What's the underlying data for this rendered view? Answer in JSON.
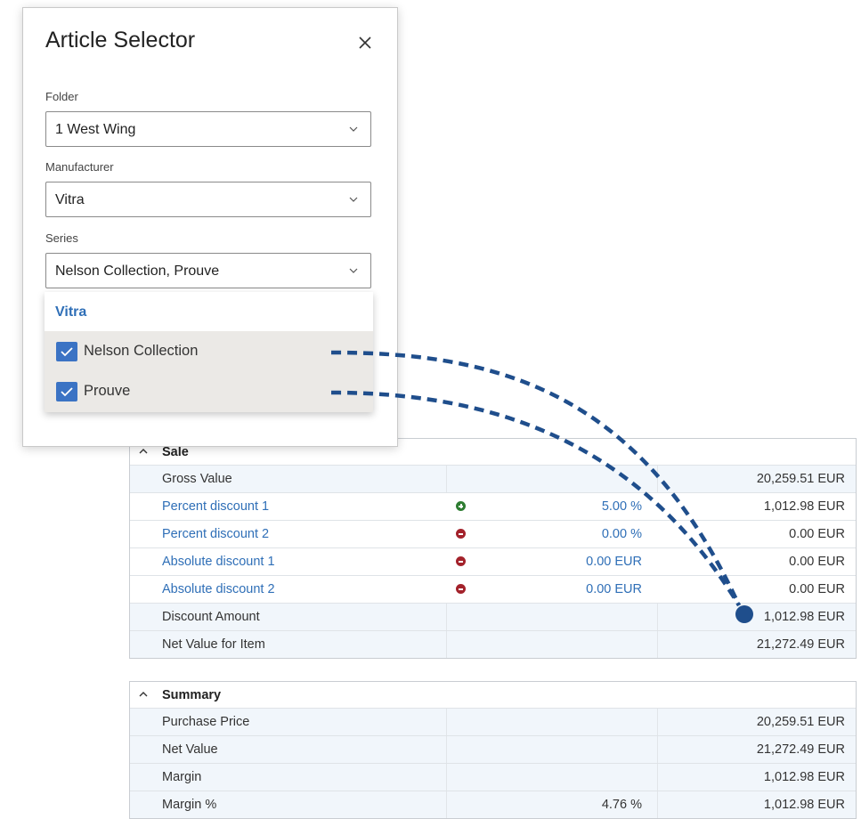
{
  "dialog": {
    "title": "Article Selector",
    "folder": {
      "label": "Folder",
      "value": "1 West Wing"
    },
    "manufacturer": {
      "label": "Manufacturer",
      "value": "Vitra"
    },
    "series": {
      "label": "Series",
      "value": "Nelson Collection, Prouve",
      "group": "Vitra",
      "options": [
        {
          "label": "Nelson Collection",
          "checked": true
        },
        {
          "label": "Prouve",
          "checked": true
        }
      ]
    }
  },
  "sale": {
    "title": "Sale",
    "rows": [
      {
        "label": "Gross Value",
        "percent": "",
        "amount": "20,259.51 EUR"
      },
      {
        "label": "Percent discount 1",
        "percent": "5.00 %",
        "amount": "1,012.98 EUR",
        "sign": "plus"
      },
      {
        "label": "Percent discount 2",
        "percent": "0.00 %",
        "amount": "0.00 EUR",
        "sign": "minus"
      },
      {
        "label": "Absolute discount 1",
        "percent": "0.00 EUR",
        "amount": "0.00 EUR",
        "sign": "minus"
      },
      {
        "label": "Absolute discount 2",
        "percent": "0.00 EUR",
        "amount": "0.00 EUR",
        "sign": "minus"
      },
      {
        "label": "Discount Amount",
        "percent": "",
        "amount": "1,012.98 EUR"
      },
      {
        "label": "Net Value for Item",
        "percent": "",
        "amount": "21,272.49 EUR"
      }
    ]
  },
  "summary": {
    "title": "Summary",
    "rows": [
      {
        "label": "Purchase Price",
        "percent": "",
        "amount": "20,259.51 EUR"
      },
      {
        "label": "Net Value",
        "percent": "",
        "amount": "21,272.49 EUR"
      },
      {
        "label": "Margin",
        "percent": "",
        "amount": "1,012.98 EUR"
      },
      {
        "label": "Margin %",
        "percent": "4.76 %",
        "amount": "1,012.98 EUR"
      }
    ]
  },
  "colors": {
    "accent": "#2f6fb7",
    "checkbox": "#3b73c4",
    "connector": "#1f4e8c",
    "plus": "#2e7d32",
    "minus": "#a3222b"
  }
}
